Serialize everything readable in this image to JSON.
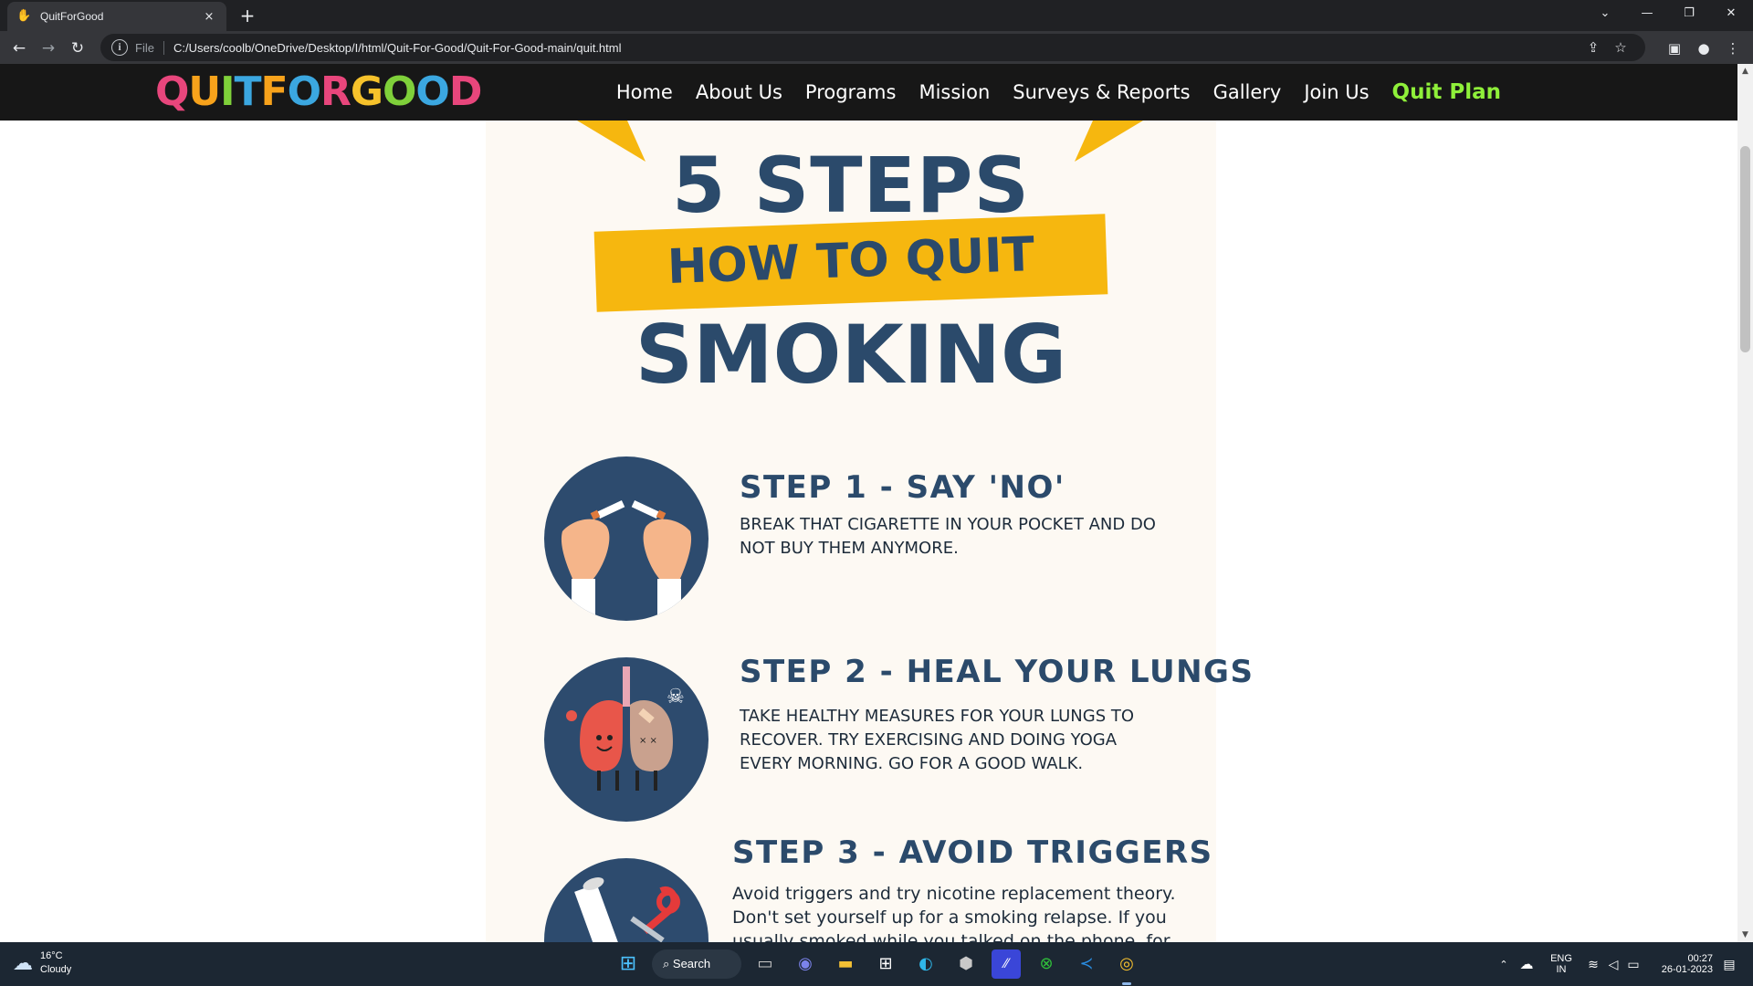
{
  "browser": {
    "tab_title": "QuitForGood",
    "tab_close": "×",
    "new_tab": "+",
    "omnibox_scheme": "File",
    "url": "C:/Users/coolb/OneDrive/Desktop/I/html/Quit-For-Good/Quit-For-Good-main/quit.html"
  },
  "site": {
    "logo_letters": [
      "Q",
      "U",
      "I",
      "T",
      "F",
      "O",
      "R",
      "G",
      "O",
      "O",
      "D"
    ],
    "logo_colors": [
      "#e8467c",
      "#f7a21b",
      "#7fd03a",
      "#3ba7e0",
      "#f7a21b",
      "#3ba7e0",
      "#e8467c",
      "#f6c22b",
      "#7fd03a",
      "#3ba7e0",
      "#e8467c"
    ],
    "nav": [
      "Home",
      "About Us",
      "Programs",
      "Mission",
      "Surveys & Reports",
      "Gallery",
      "Join Us"
    ],
    "nav_highlight": "Quit Plan",
    "accent_color": "#8ff03a"
  },
  "poster": {
    "heading_1": "5 STEPS",
    "heading_2": "HOW TO QUIT",
    "heading_3": "SMOKING",
    "banner_color": "#f6b70f",
    "text_color": "#2b4a6b",
    "steps": [
      {
        "title": "STEP 1 - SAY 'NO'",
        "text": "BREAK THAT CIGARETTE IN YOUR POCKET AND DO NOT BUY THEM ANYMORE.",
        "icon": "broken-cigarette-icon"
      },
      {
        "title": "STEP 2 - HEAL YOUR LUNGS",
        "text": "TAKE HEALTHY MEASURES FOR YOUR LUNGS TO RECOVER. TRY EXERCISING AND DOING YOGA EVERY MORNING. GO FOR A GOOD WALK.",
        "icon": "lungs-icon"
      },
      {
        "title": "STEP 3 - AVOID TRIGGERS",
        "text": "Avoid triggers and try nicotine replacement theory. Don't set yourself up for a smoking relapse. If you usually smoked while you talked on the phone, for",
        "icon": "scissors-cigarette-icon"
      }
    ]
  },
  "taskbar": {
    "weather_temp": "16°C",
    "weather_cond": "Cloudy",
    "search_label": "Search",
    "lang_1": "ENG",
    "lang_2": "IN",
    "time": "00:27",
    "date": "26-01-2023"
  }
}
